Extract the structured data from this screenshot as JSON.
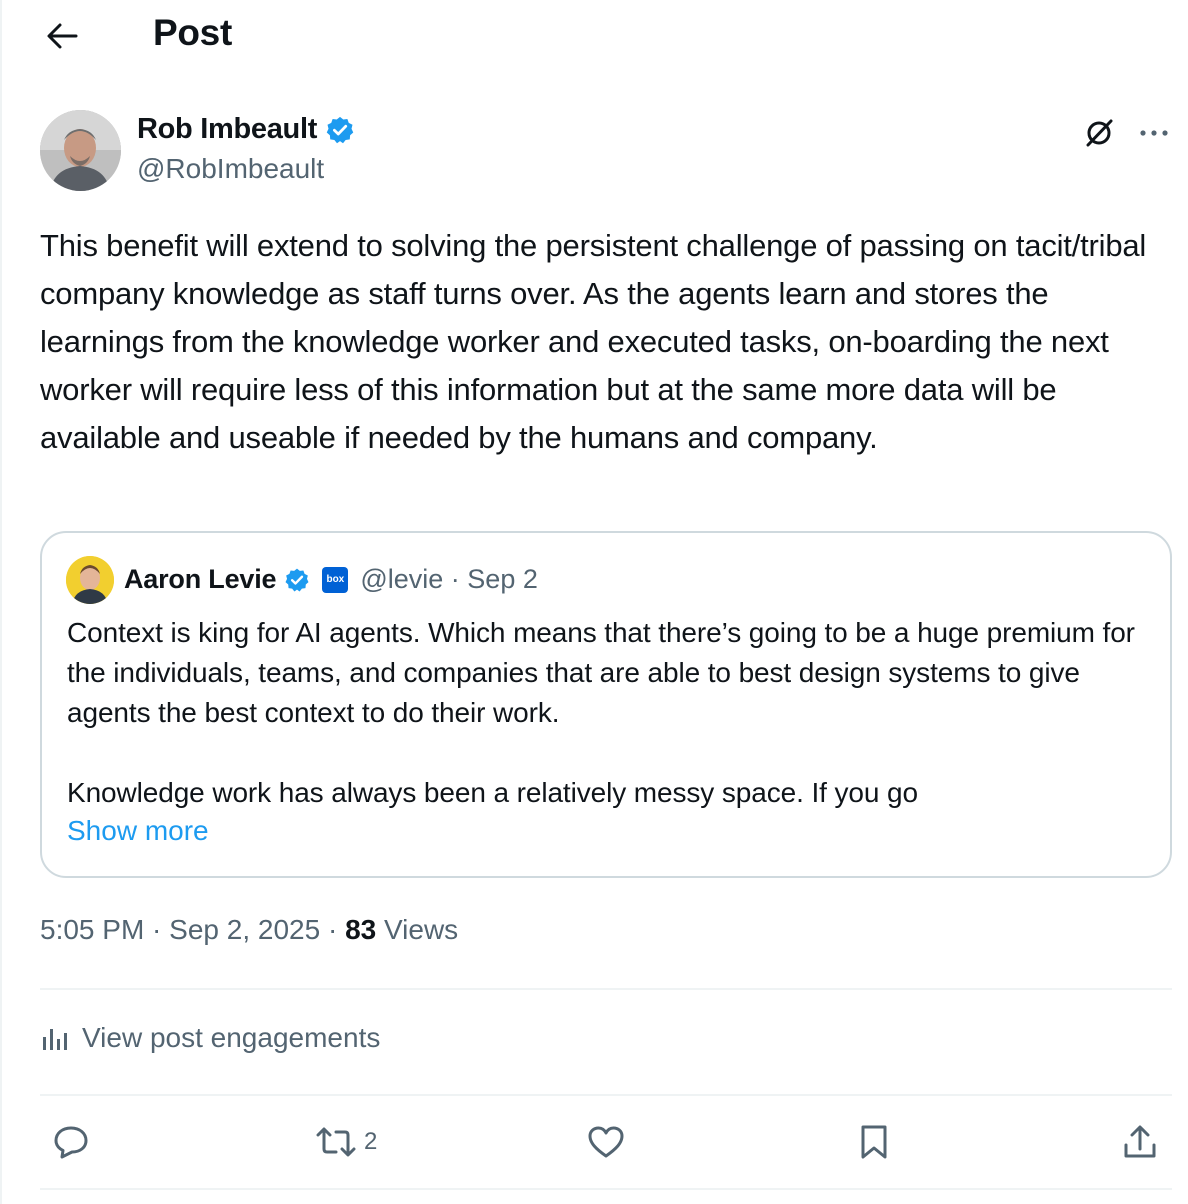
{
  "header": {
    "title": "Post"
  },
  "author": {
    "name": "Rob Imbeault",
    "handle": "@RobImbeault"
  },
  "tweet": {
    "text": "This benefit will extend to solving the persistent challenge of passing on tacit/tribal company knowledge as staff turns over. As the agents learn and stores the learnings from the knowledge worker and executed tasks, on-boarding the next worker will require less of this information but at the same more data will be available and useable if needed by the humans and company."
  },
  "quote": {
    "name": "Aaron Levie",
    "affiliate_badge": "box",
    "handle_date": "@levie · Sep 2",
    "paragraph1": "Context is king for AI agents. Which means that there’s going to be a huge premium for the individuals, teams, and companies that are able to best design systems to give agents the best context to do their work.",
    "paragraph2": "Knowledge work has always been a relatively messy space. If you go",
    "show_more": "Show more"
  },
  "meta": {
    "time_date": "5:05 PM · Sep 2, 2025 · ",
    "views_count": "83",
    "views_label": " Views"
  },
  "engagements": {
    "label": "View post engagements"
  },
  "actions": {
    "reply_icon": "reply-icon",
    "repost_count": "2",
    "like_icon": "heart-icon",
    "bookmark_icon": "bookmark-icon",
    "share_icon": "share-icon"
  },
  "colors": {
    "accent": "#1d9bf0",
    "text_primary": "#0f1419",
    "text_secondary": "#536471",
    "border": "#cfd9de",
    "divider": "#eff3f4",
    "verified": "#1d9bf0",
    "box_brand": "#0061d5"
  }
}
